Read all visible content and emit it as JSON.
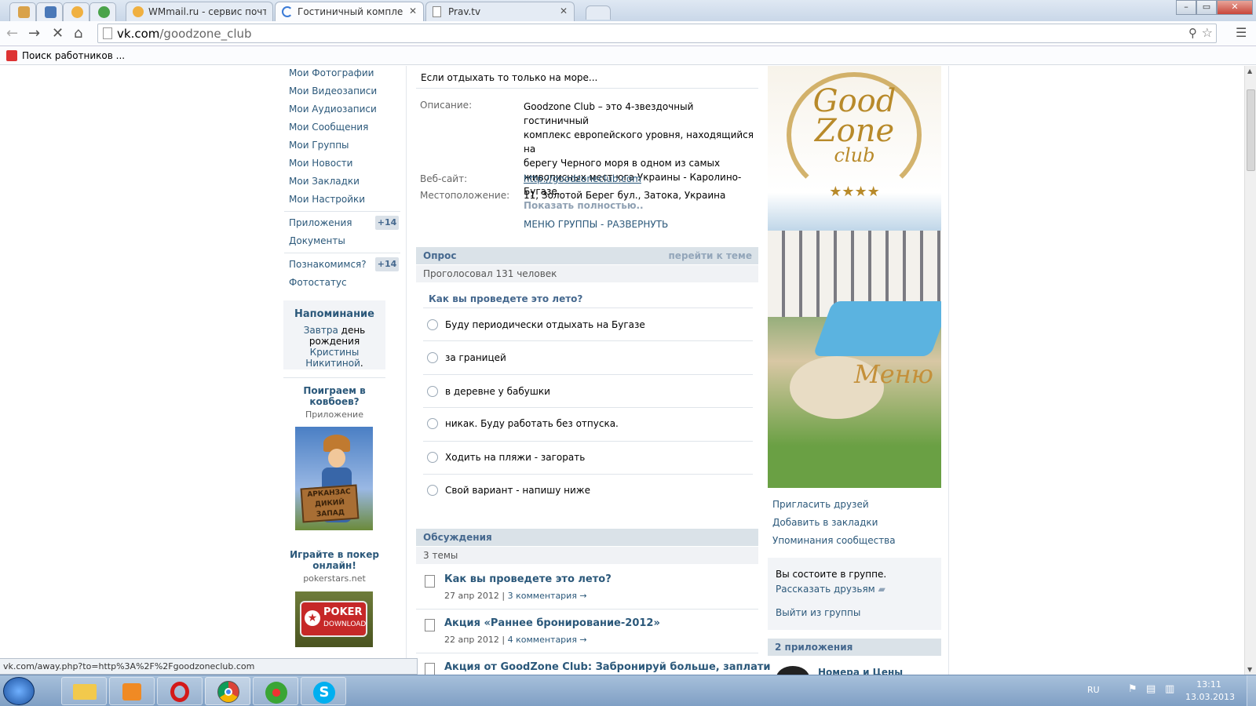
{
  "browser": {
    "tabs": [
      {
        "title": "WMmail.ru - сервис почт"
      },
      {
        "title": "Гостиничный комплекс G"
      },
      {
        "title": "Prav.tv"
      }
    ],
    "url_domain": "vk.com",
    "url_path": "/goodzone_club",
    "bookmark": "Поиск работников ...",
    "status_url": "vk.com/away.php?to=http%3A%2F%2Fgoodzoneclub.com",
    "window_buttons": [
      "–",
      "▭",
      "✕"
    ]
  },
  "left_menu": {
    "items": [
      "Мои Фотографии",
      "Мои Видеозаписи",
      "Мои Аудиозаписи",
      "Мои Сообщения",
      "Мои Группы",
      "Мои Новости",
      "Мои Закладки",
      "Мои Настройки"
    ],
    "apps_label": "Приложения",
    "apps_badge": "+14",
    "docs_label": "Документы",
    "meet_label": "Познакомимся?",
    "meet_badge": "+14",
    "photostatus_label": "Фотостатус"
  },
  "reminder": {
    "title": "Напоминание",
    "line1": "Завтра",
    "line1b": " день",
    "line2a": "рождения ",
    "line2b": "Кристины",
    "line3": "Никитиной",
    "line3end": "."
  },
  "ads": [
    {
      "title": "Поиграем в ковбоев?",
      "sub": "Приложение",
      "sign": "АРКАНЗАС ДИКИЙ ЗАПАД"
    },
    {
      "title": "Играйте в покер онлайн!",
      "sub": "pokerstars.net",
      "logo_line1": "POKER",
      "logo_line2": "DOWNLOAD"
    }
  ],
  "group_info": {
    "status": "Если отдыхать то только на море...",
    "description_label": "Описание:",
    "description": [
      "Goodzone Club – это 4-звездочный гостиничный",
      "комплекс европейского уровня, находящийся на",
      "берегу Черного моря в одном из самых",
      "живописных мест юга Украины - Каролино-Бугазе."
    ],
    "show_full": "Показать полностью..",
    "website_label": "Веб-сайт:",
    "website": "http://goodzoneclub.com",
    "location_label": "Местоположение:",
    "location": "11, Золотой Берег бул., Затока, Украина",
    "menu_link": "МЕНЮ ГРУППЫ - РАЗВЕРНУТЬ"
  },
  "poll": {
    "header": "Опрос",
    "goto": "перейти к теме",
    "voted": "Проголосовал 131 человек",
    "question": "Как вы проведете это лето?",
    "options": [
      "Буду периодически отдыхать на Бугазе",
      "за границей",
      "в деревне у бабушки",
      "никак. Буду работать без отпуска.",
      "Ходить на пляжи - загорать",
      "Свой вариант - напишу ниже"
    ]
  },
  "discussions": {
    "header": "Обсуждения",
    "count": "3 темы",
    "topics": [
      {
        "title": "Как вы проведете это лето?",
        "date": "27 апр 2012",
        "comments": "3 комментария →"
      },
      {
        "title": "Акция «Раннее бронирование-2012»",
        "date": "22 апр 2012",
        "comments": "4 комментария →"
      },
      {
        "title": "Акция от GoodZone Club: Забронируй больше, заплати",
        "date": "",
        "comments": ""
      }
    ]
  },
  "right": {
    "logo_line1": "Good",
    "logo_line2": "Zone",
    "logo_line3": "club",
    "stars": "★★★★",
    "menu_text": "Меню",
    "actions": [
      "Пригласить друзей",
      "Добавить в закладки",
      "Упоминания сообщества"
    ],
    "member_status": "Вы состоите в группе.",
    "tell_friends": "Рассказать друзьям",
    "leave": "Выйти из группы",
    "apps_header": "2 приложения",
    "app1": "Номера и Цены"
  },
  "tray": {
    "lang": "RU",
    "time": "13:11",
    "date": "13.03.2013"
  },
  "colors": {
    "vk_link": "#2b587a",
    "vk_header_bg": "#dae2e8",
    "taskbar": "#8faccd"
  }
}
